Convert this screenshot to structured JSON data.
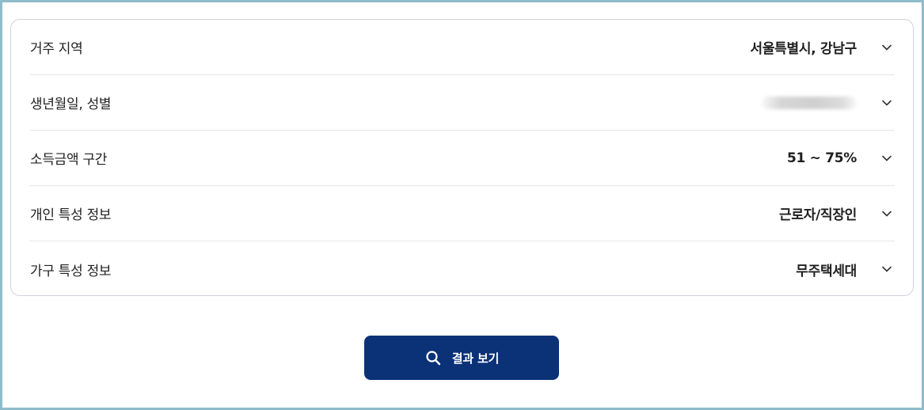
{
  "filters": {
    "rows": [
      {
        "label": "거주 지역",
        "value": "서울특별시, 강남구"
      },
      {
        "label": "생년월일, 성별",
        "value": ""
      },
      {
        "label": "소득금액 구간",
        "value": "51 ~ 75%"
      },
      {
        "label": "개인 특성 정보",
        "value": "근로자/직장인"
      },
      {
        "label": "가구 특성 정보",
        "value": "무주택세대"
      }
    ]
  },
  "action": {
    "result_label": "결과 보기"
  },
  "colors": {
    "button_bg": "#0b3177",
    "frame_border": "#8fbccb",
    "card_border": "#cfd3da",
    "divider": "#e4e6ea"
  },
  "icons": {
    "row_chevron": "chevron-down-icon",
    "button_icon": "search-icon"
  }
}
